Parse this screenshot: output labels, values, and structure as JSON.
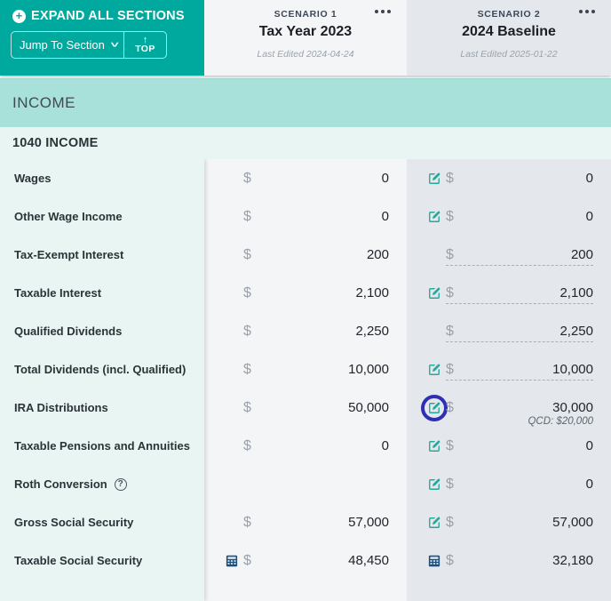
{
  "header": {
    "expand_all_label": "EXPAND ALL SECTIONS",
    "expand_icon": "plus-circle-icon",
    "jump_to_section_label": "Jump To Section",
    "jump_chevron_icon": "chevron-down-icon",
    "top_arrow_icon": "arrow-up-icon",
    "top_label": "TOP",
    "menu_icon": "ellipsis-icon",
    "accent_teal": "#00a99d",
    "scenarios": [
      {
        "kicker": "SCENARIO 1",
        "title": "Tax Year 2023",
        "last_edited": "Last Edited 2024-04-24"
      },
      {
        "kicker": "SCENARIO 2",
        "title": "2024 Baseline",
        "last_edited": "Last Edited 2025-01-22"
      }
    ]
  },
  "section": {
    "banner_title": "INCOME",
    "banner_color": "#a8e0da",
    "subsection_title": "1040 INCOME",
    "subsection_color": "#e8f5f2"
  },
  "table": {
    "currency_symbol": "$",
    "rows": [
      {
        "label": "Wages",
        "s1": {
          "value": "0",
          "show_dollar": true,
          "icon": null,
          "editable": false
        },
        "s2": {
          "value": "0",
          "show_dollar": true,
          "icon": "edit-icon",
          "editable": false
        }
      },
      {
        "label": "Other Wage Income",
        "s1": {
          "value": "0",
          "show_dollar": true,
          "icon": null,
          "editable": false
        },
        "s2": {
          "value": "0",
          "show_dollar": true,
          "icon": "edit-icon",
          "editable": false
        }
      },
      {
        "label": "Tax-Exempt Interest",
        "s1": {
          "value": "200",
          "show_dollar": true,
          "icon": null,
          "editable": false
        },
        "s2": {
          "value": "200",
          "show_dollar": true,
          "icon": null,
          "editable": true
        }
      },
      {
        "label": "Taxable Interest",
        "s1": {
          "value": "2,100",
          "show_dollar": true,
          "icon": null,
          "editable": false
        },
        "s2": {
          "value": "2,100",
          "show_dollar": true,
          "icon": "edit-icon",
          "editable": true
        }
      },
      {
        "label": "Qualified Dividends",
        "s1": {
          "value": "2,250",
          "show_dollar": true,
          "icon": null,
          "editable": false
        },
        "s2": {
          "value": "2,250",
          "show_dollar": true,
          "icon": null,
          "editable": true
        }
      },
      {
        "label": "Total Dividends (incl. Qualified)",
        "s1": {
          "value": "10,000",
          "show_dollar": true,
          "icon": null,
          "editable": false
        },
        "s2": {
          "value": "10,000",
          "show_dollar": true,
          "icon": "edit-icon",
          "editable": true
        }
      },
      {
        "label": "IRA Distributions",
        "s1": {
          "value": "50,000",
          "show_dollar": true,
          "icon": null,
          "editable": false
        },
        "s2": {
          "value": "30,000",
          "show_dollar": true,
          "icon": "edit-icon",
          "editable": false,
          "highlighted": true,
          "highlight_color": "#2f2fb5",
          "note": "QCD: $20,000"
        }
      },
      {
        "label": "Taxable Pensions and Annuities",
        "s1": {
          "value": "0",
          "show_dollar": true,
          "icon": null,
          "editable": false
        },
        "s2": {
          "value": "0",
          "show_dollar": true,
          "icon": "edit-icon",
          "editable": false
        }
      },
      {
        "label": "Roth Conversion",
        "has_help": true,
        "help_icon": "question-mark-circle-icon",
        "s1": {
          "value": "",
          "show_dollar": false,
          "icon": null,
          "editable": false
        },
        "s2": {
          "value": "0",
          "show_dollar": true,
          "icon": "edit-icon",
          "editable": false
        }
      },
      {
        "label": "Gross Social Security",
        "s1": {
          "value": "57,000",
          "show_dollar": true,
          "icon": null,
          "editable": false
        },
        "s2": {
          "value": "57,000",
          "show_dollar": true,
          "icon": "edit-icon",
          "editable": false
        }
      },
      {
        "label": "Taxable Social Security",
        "s1": {
          "value": "48,450",
          "show_dollar": true,
          "icon": "calculator-icon",
          "editable": false
        },
        "s2": {
          "value": "32,180",
          "show_dollar": true,
          "icon": "calculator-icon",
          "editable": false
        }
      }
    ]
  }
}
